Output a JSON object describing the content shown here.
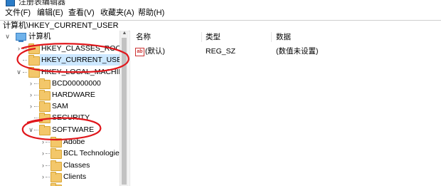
{
  "window": {
    "title": "注册表编辑器"
  },
  "menu": [
    {
      "label": "文件(F)"
    },
    {
      "label": "编辑(E)"
    },
    {
      "label": "查看(V)"
    },
    {
      "label": "收藏夹(A)"
    },
    {
      "label": "帮助(H)"
    }
  ],
  "address": {
    "path": "计算机\\HKEY_CURRENT_USER"
  },
  "tree": {
    "root": {
      "label": "计算机"
    },
    "hkcr": {
      "label": "HKEY_CLASSES_ROOT"
    },
    "hkcu": {
      "label": "HKEY_CURRENT_USER",
      "selected": true
    },
    "hklm": {
      "label": "HKEY_LOCAL_MACHINE"
    },
    "bcd": {
      "label": "BCD00000000"
    },
    "hardware": {
      "label": "HARDWARE"
    },
    "sam": {
      "label": "SAM"
    },
    "security": {
      "label": "SECURITY"
    },
    "software": {
      "label": "SOFTWARE"
    },
    "adobe": {
      "label": "Adobe"
    },
    "bcl": {
      "label": "BCL Technologie"
    },
    "classes": {
      "label": "Classes"
    },
    "clients": {
      "label": "Clients"
    }
  },
  "list": {
    "columns": {
      "name": "名称",
      "type": "类型",
      "data": "数据"
    },
    "rows": [
      {
        "name": "(默认)",
        "type": "REG_SZ",
        "data": "(数值未设置)",
        "icon": "ab-string-icon"
      }
    ]
  },
  "colors": {
    "selection": "#cde8ff",
    "annotation": "#e0161b",
    "folder": "#f3c76a"
  }
}
